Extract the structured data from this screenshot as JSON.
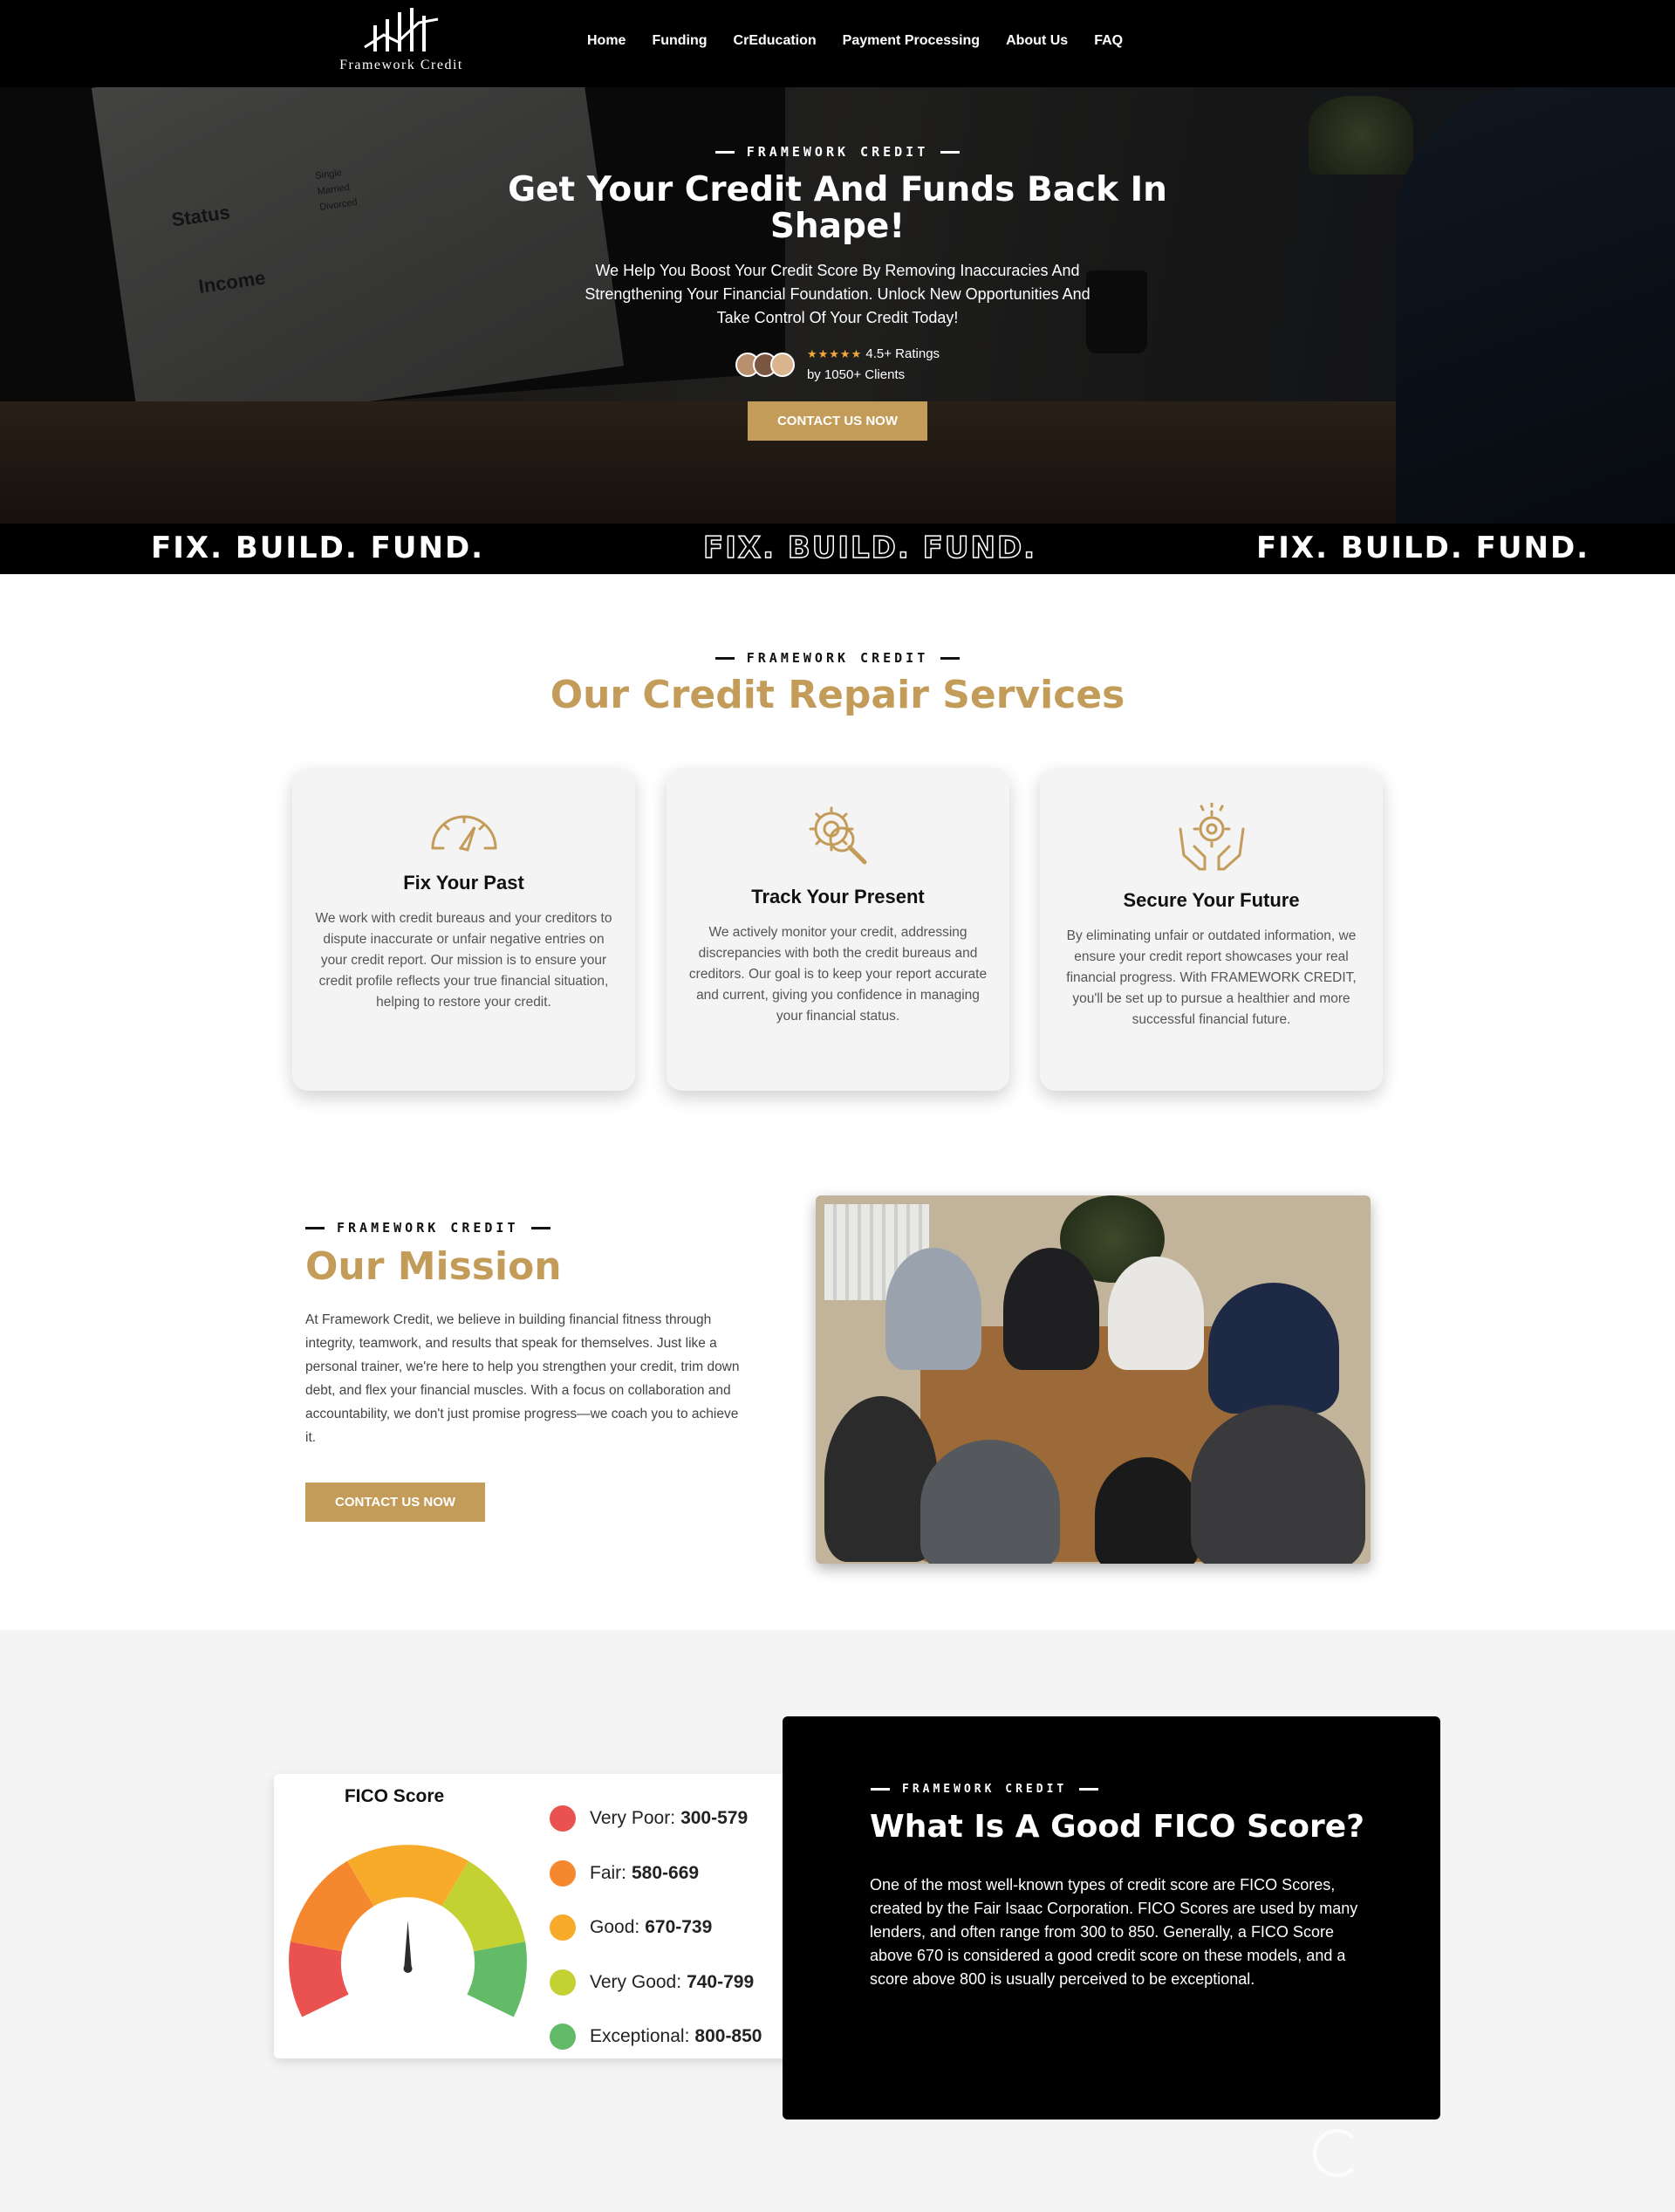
{
  "nav": {
    "logo_text": "Framework Credit",
    "links": [
      "Home",
      "Funding",
      "CrEducation",
      "Payment Processing",
      "About Us",
      "FAQ"
    ]
  },
  "hero": {
    "eyebrow": "FRAMEWORK CREDIT",
    "title": "Get Your Credit And Funds Back In Shape!",
    "subtitle": "We Help You Boost Your Credit Score By Removing Inaccuracies And Strengthening Your Financial Foundation. Unlock New Opportunities And Take Control Of Your Credit Today!",
    "stars": "★★★★★",
    "rating_label": "4.5+ Ratings",
    "clients_label": "by 1050+ Clients",
    "cta_label": "CONTACT US NOW",
    "paper_words": [
      "Status",
      "Income",
      "Single",
      "Married",
      "Divorced"
    ]
  },
  "tagline": {
    "items": [
      "FIX. BUILD. FUND.",
      "FIX. BUILD. FUND.",
      "FIX. BUILD. FUND."
    ]
  },
  "services": {
    "eyebrow": "FRAMEWORK CREDIT",
    "title": "Our Credit Repair Services",
    "cards": [
      {
        "icon": "speedometer-icon",
        "title": "Fix Your Past",
        "desc": "We work with credit bureaus and your creditors to dispute inaccurate or unfair negative entries on your credit report. Our mission is to ensure your credit profile reflects your true financial situation, helping to restore your credit."
      },
      {
        "icon": "gear-magnifier-icon",
        "title": "Track Your Present",
        "desc": "We actively monitor your credit, addressing discrepancies with both the credit bureaus and creditors. Our goal is to keep your report accurate and current, giving you confidence in managing your financial status."
      },
      {
        "icon": "hands-gear-icon",
        "title": "Secure Your Future",
        "desc": "By eliminating unfair or outdated information, we ensure your credit report showcases your real financial progress. With FRAMEWORK CREDIT, you'll be set up to pursue a healthier and more successful financial future."
      }
    ]
  },
  "mission": {
    "eyebrow": "FRAMEWORK CREDIT",
    "title": "Our Mission",
    "text": "At Framework Credit, we believe in building financial fitness through integrity, teamwork, and results that speak for themselves.  Just like a personal trainer, we're here to help you strengthen your credit, trim down debt, and flex your financial muscles.  With a focus on collaboration and accountability, we don't just promise progress—we coach you to achieve it.",
    "cta_label": "CONTACT US NOW"
  },
  "fico": {
    "card_title": "FICO Score",
    "legend": [
      {
        "label": "Very Poor:",
        "range": "300-579",
        "color": "#e9524f"
      },
      {
        "label": "Fair:",
        "range": "580-669",
        "color": "#f5882e"
      },
      {
        "label": "Good:",
        "range": "670-739",
        "color": "#f8aa2b"
      },
      {
        "label": "Very Good:",
        "range": "740-799",
        "color": "#c4d132"
      },
      {
        "label": "Exceptional:",
        "range": "800-850",
        "color": "#63bb67"
      }
    ],
    "eyebrow": "FRAMEWORK CREDIT",
    "title": "What Is A Good FICO Score?",
    "text": "One of the most well-known types of credit score are FICO Scores, created by the Fair Isaac Corporation. FICO Scores are used by many lenders, and often range from 300 to 850. Generally, a FICO Score above 670 is considered a good credit score on these models, and a score above 800 is usually perceived to be exceptional."
  },
  "colors": {
    "accent_gold": "#c49c5a",
    "nav_bg": "#000000",
    "section_bg": "#f4f4f4"
  }
}
